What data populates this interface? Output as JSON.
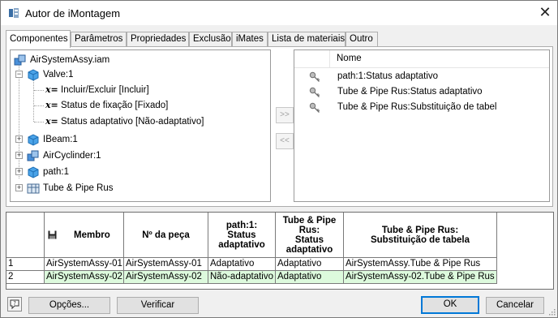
{
  "window": {
    "title": "Autor de iMontagem",
    "close_glyph": "✕",
    "icon": "imontagem-app-icon"
  },
  "tabs": [
    {
      "label": "Componentes",
      "active": true
    },
    {
      "label": "Parâmetros"
    },
    {
      "label": "Propriedades"
    },
    {
      "label": "Exclusão"
    },
    {
      "label": "iMates"
    },
    {
      "label": "Lista de materiais"
    },
    {
      "label": "Outro"
    }
  ],
  "tree": {
    "root": {
      "label": "AirSystemAssy.iam",
      "icon": "assembly-icon"
    },
    "items": [
      {
        "label": "Valve:1",
        "icon": "part-icon",
        "expanded": true
      },
      {
        "label": "Incluir/Excluir [Incluir]",
        "icon": "x-equals-icon"
      },
      {
        "label": "Status de fixação [Fixado]",
        "icon": "x-equals-icon"
      },
      {
        "label": "Status adaptativo [Não-adaptativo]",
        "icon": "x-equals-icon"
      },
      {
        "label": "IBeam:1",
        "icon": "part-icon",
        "expanded": false
      },
      {
        "label": "AirCyclinder:1",
        "icon": "subassembly-icon",
        "expanded": false
      },
      {
        "label": "path:1",
        "icon": "part-icon",
        "expanded": false
      },
      {
        "label": "Tube & Pipe Rus",
        "icon": "tube-pipe-icon",
        "expanded": false
      }
    ]
  },
  "transfer": {
    "add": ">>",
    "remove": "<<"
  },
  "selected_list": {
    "header": "Nome",
    "items": [
      {
        "label": "path:1:Status adaptativo",
        "icon": "key-icon"
      },
      {
        "label": "Tube & Pipe Rus:Status adaptativo",
        "icon": "key-icon"
      },
      {
        "label": "Tube & Pipe Rus:Substituição de tabel",
        "icon": "key-icon"
      }
    ]
  },
  "table": {
    "columns": [
      "",
      "Membro",
      "Nº da peça",
      "path:1:\nStatus\nadaptativo",
      "Tube & Pipe\nRus:\nStatus\nadaptativo",
      "Tube & Pipe Rus:\nSubstituição de tabela"
    ],
    "rows": [
      [
        "1",
        "AirSystemAssy-01",
        "AirSystemAssy-01",
        "Adaptativo",
        "Adaptativo",
        "AirSystemAssy.Tube & Pipe Rus"
      ],
      [
        "2",
        "AirSystemAssy-02",
        "AirSystemAssy-02",
        "Não-adaptativo",
        "Adaptativo",
        "AirSystemAssy-02.Tube & Pipe Rus"
      ]
    ],
    "highlight_color": "#ddfadd"
  },
  "buttons": {
    "options": "Opções...",
    "verify": "Verificar",
    "ok": "OK",
    "cancel": "Cancelar"
  },
  "colors": {
    "accent": "#0078d7"
  }
}
